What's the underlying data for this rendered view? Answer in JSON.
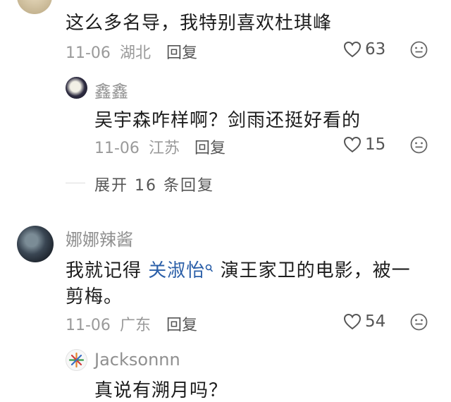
{
  "comments": [
    {
      "text": "这么多名导，我特别喜欢杜琪峰",
      "date": "11-06",
      "location": "湖北",
      "reply_label": "回复",
      "likes": "63",
      "replies": [
        {
          "username": "鑫鑫",
          "text": "吴宇森咋样啊？剑雨还挺好看的",
          "date": "11-06",
          "location": "江苏",
          "reply_label": "回复",
          "likes": "15"
        }
      ],
      "expand_label": "展开 16 条回复"
    },
    {
      "username": "娜娜辣酱",
      "text_before": "我就记得",
      "link_text": "关淑怡",
      "text_after": "演王家卫的电影，被一",
      "text_line2": "剪梅。",
      "date": "11-06",
      "location": "广东",
      "reply_label": "回复",
      "likes": "54",
      "replies": [
        {
          "username": "Jacksonnn",
          "text": "真说有溯月吗？"
        }
      ]
    }
  ],
  "icons": {
    "heart": "heart-outline-icon",
    "emoji": "emoji-face-icon",
    "search": "search-icon"
  },
  "colors": {
    "link": "#2b5fa8",
    "meta": "#9a9a9a"
  }
}
